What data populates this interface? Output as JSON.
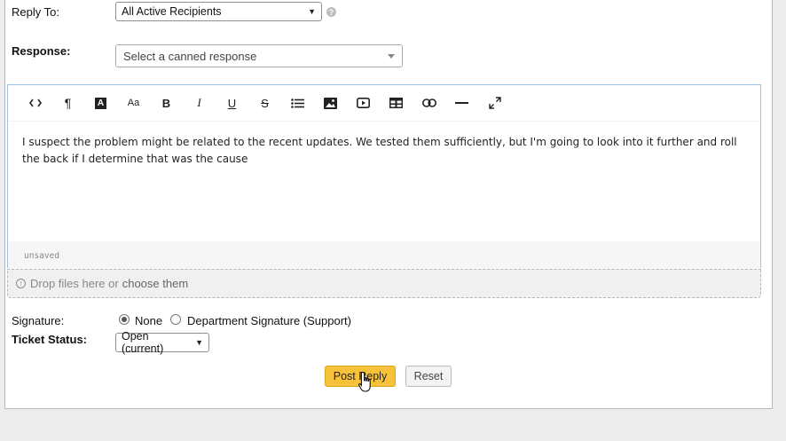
{
  "reply_to": {
    "label": "Reply To:",
    "value": "All Active Recipients",
    "help_icon": "question-icon"
  },
  "response": {
    "label": "Response:",
    "placeholder": "Select a canned response"
  },
  "editor": {
    "toolbar": [
      {
        "name": "code-view-icon",
        "glyph": "<>"
      },
      {
        "name": "paragraph-icon",
        "glyph": "¶"
      },
      {
        "name": "text-color-icon",
        "glyph": "A"
      },
      {
        "name": "font-size-icon",
        "glyph": "Aa"
      },
      {
        "name": "bold-icon",
        "glyph": "B"
      },
      {
        "name": "italic-icon",
        "glyph": "I"
      },
      {
        "name": "underline-icon",
        "glyph": "U"
      },
      {
        "name": "strikethrough-icon",
        "glyph": "S"
      },
      {
        "name": "bullet-list-icon",
        "glyph": "list"
      },
      {
        "name": "image-icon",
        "glyph": "img"
      },
      {
        "name": "video-icon",
        "glyph": "video"
      },
      {
        "name": "table-icon",
        "glyph": "table"
      },
      {
        "name": "link-icon",
        "glyph": "link"
      },
      {
        "name": "horizontal-rule-icon",
        "glyph": "hr"
      },
      {
        "name": "fullscreen-icon",
        "glyph": "full"
      }
    ],
    "body": "I suspect the problem might be related to the recent updates. We tested them sufficiently, but I'm going to look into it further and roll the back if I determine that was the cause",
    "status": "unsaved"
  },
  "dropzone": {
    "text": "Drop files here or",
    "link": "choose them"
  },
  "signature": {
    "label": "Signature:",
    "options": [
      "None",
      "Department Signature (Support)"
    ],
    "selected": "None"
  },
  "ticket_status": {
    "label": "Ticket Status:",
    "value": "Open (current)"
  },
  "buttons": {
    "post": "Post Reply",
    "reset": "Reset"
  },
  "colors": {
    "primary_button": "#f7c23a",
    "editor_border": "#9ec1e8"
  }
}
